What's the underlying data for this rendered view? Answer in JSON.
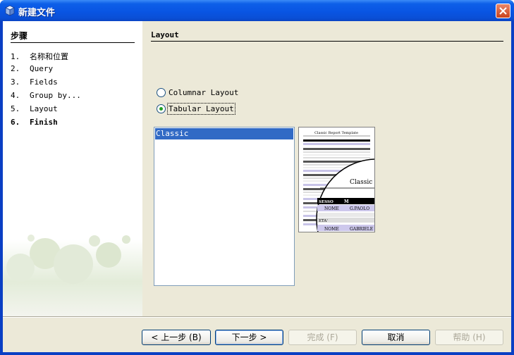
{
  "window": {
    "title": "新建文件"
  },
  "steps": {
    "heading": "步骤",
    "items": [
      {
        "num": "1.",
        "label": "名称和位置"
      },
      {
        "num": "2.",
        "label": "Query"
      },
      {
        "num": "3.",
        "label": "Fields"
      },
      {
        "num": "4.",
        "label": "Group by..."
      },
      {
        "num": "5.",
        "label": "Layout"
      },
      {
        "num": "6.",
        "label": "Finish"
      }
    ],
    "current_index": 5
  },
  "content": {
    "title": "Layout",
    "layout_options": [
      {
        "label": "Columnar Layout",
        "selected": false
      },
      {
        "label": "Tabular Layout",
        "selected": true
      }
    ],
    "templates": [
      "Classic"
    ],
    "selected_template": "Classic",
    "preview": {
      "title": "Classic Report Template",
      "zoom_label": "Classic",
      "row_labels": [
        "SESSO",
        "NOME",
        "ETA'",
        "NOME"
      ],
      "row_values": [
        "M",
        "G.PAOLO",
        "",
        "GABRIELE"
      ]
    }
  },
  "buttons": {
    "back": "< 上一步 (B)",
    "next": "下一步 >",
    "finish": "完成 (F)",
    "cancel": "取消",
    "help": "帮助 (H)"
  },
  "colors": {
    "titlebar": "#0955e3",
    "selection": "#316ac5",
    "dialog_bg": "#ece9d8"
  }
}
